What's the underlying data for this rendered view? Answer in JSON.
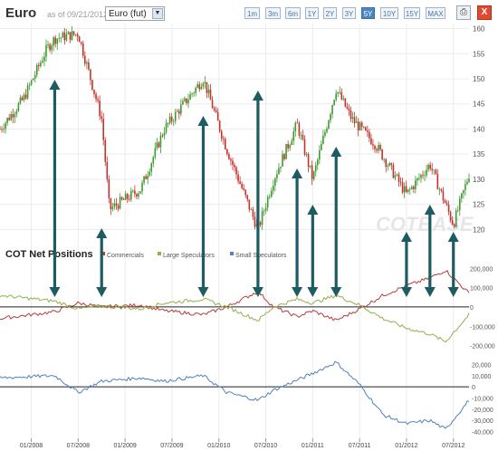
{
  "header": {
    "title": "Euro",
    "as_of": "as of 09/21/2012",
    "contract_select": "Euro (fut)",
    "ranges": [
      "1m",
      "3m",
      "6m",
      "1Y",
      "2Y",
      "3Y",
      "5Y",
      "10Y",
      "15Y",
      "MAX"
    ],
    "active_range": "5Y",
    "print_icon": "printer-icon",
    "close_label": "X"
  },
  "chart_data": {
    "type": "line",
    "price_panel": {
      "series": "Euro futures price (candlestick)",
      "ylim": [
        117,
        161
      ],
      "y_ticks": [
        "160",
        "155",
        "150",
        "145",
        "140",
        "135",
        "130",
        "125",
        "120"
      ],
      "x_range": [
        "2007-09",
        "2012-09"
      ],
      "x": [
        "2007-09",
        "2007-12",
        "2008-03",
        "2008-04",
        "2008-07",
        "2008-10",
        "2008-11",
        "2009-03",
        "2009-06",
        "2009-09",
        "2009-11",
        "2010-02",
        "2010-06",
        "2010-08",
        "2010-11",
        "2011-01",
        "2011-04",
        "2011-06",
        "2011-09",
        "2012-01",
        "2012-04",
        "2012-07",
        "2012-09"
      ],
      "values": [
        140,
        146,
        156,
        158,
        159,
        142,
        124,
        128,
        140,
        146,
        150,
        136,
        120,
        130,
        141,
        130,
        148,
        142,
        137,
        127,
        133,
        121,
        131
      ]
    },
    "watermark": "COTBASE",
    "cot_panel": {
      "title": "COT Net Positions",
      "legend": [
        "Commercials",
        "Large Speculators",
        "Small Speculators"
      ],
      "legend_position": "top",
      "colors": {
        "Commercials": "#b93b3b",
        "Large Speculators": "#8fb14b",
        "Small Speculators": "#4f81bd"
      },
      "upper_y_ticks": [
        "200,000",
        "100,000",
        "0",
        "-100,000",
        "-200,000"
      ],
      "upper_ylim": [
        -230000,
        220000
      ],
      "lower_y_ticks": [
        "20,000",
        "10,000",
        "0",
        "-10,000",
        "-20,000",
        "-30,000",
        "-40,000"
      ],
      "lower_ylim": [
        -46000,
        26000
      ],
      "x": [
        "2007-09",
        "2008-04",
        "2008-07",
        "2008-10",
        "2009-03",
        "2009-06",
        "2009-11",
        "2010-02",
        "2010-06",
        "2010-08",
        "2010-11",
        "2011-01",
        "2011-04",
        "2011-07",
        "2011-10",
        "2012-01",
        "2012-04",
        "2012-06",
        "2012-09"
      ],
      "series": [
        {
          "name": "Commercials",
          "values": [
            -60000,
            -25000,
            20000,
            0,
            10000,
            -20000,
            -40000,
            0,
            80000,
            0,
            -50000,
            -20000,
            -70000,
            -10000,
            60000,
            110000,
            150000,
            190000,
            70000
          ]
        },
        {
          "name": "Large Speculators",
          "values": [
            60000,
            30000,
            -10000,
            5000,
            -10000,
            20000,
            40000,
            0,
            -70000,
            0,
            40000,
            20000,
            60000,
            10000,
            -60000,
            -110000,
            -140000,
            -180000,
            -40000
          ]
        },
        {
          "name": "Small Speculators",
          "values": [
            8000,
            10000,
            -5000,
            5000,
            8000,
            5000,
            10000,
            -5000,
            -12000,
            -3000,
            6000,
            12000,
            22000,
            2000,
            -25000,
            -33000,
            -30000,
            -38000,
            -12000
          ]
        }
      ]
    },
    "x_tick_labels": [
      "01/2008",
      "07/2008",
      "01/2009",
      "07/2009",
      "01/2010",
      "07/2010",
      "01/2011",
      "07/2011",
      "01/2012",
      "07/2012"
    ],
    "x_tick_dates": [
      "2008-01",
      "2008-07",
      "2009-01",
      "2009-07",
      "2010-01",
      "2010-07",
      "2011-01",
      "2011-07",
      "2012-01",
      "2012-07"
    ],
    "arrows": [
      {
        "date": "2008-04",
        "direction": "both"
      },
      {
        "date": "2008-10",
        "direction": "both"
      },
      {
        "date": "2009-11",
        "direction": "both"
      },
      {
        "date": "2010-06",
        "direction": "both"
      },
      {
        "date": "2010-11",
        "direction": "both"
      },
      {
        "date": "2011-01",
        "direction": "both"
      },
      {
        "date": "2011-04",
        "direction": "both"
      },
      {
        "date": "2012-01",
        "direction": "both"
      },
      {
        "date": "2012-04",
        "direction": "both"
      },
      {
        "date": "2012-07",
        "direction": "both"
      }
    ],
    "arrow_color": "#1d5c63"
  }
}
